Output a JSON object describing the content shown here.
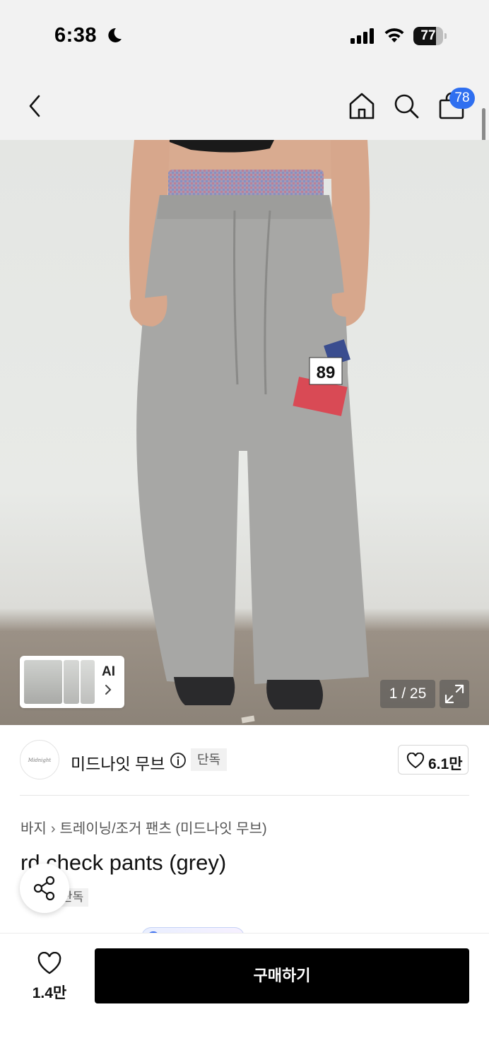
{
  "status_bar": {
    "time": "6:38",
    "battery": "77",
    "battery_level": 0.77
  },
  "nav": {
    "cart_count": "78"
  },
  "gallery": {
    "thumbnail_label": "AI",
    "counter": "1 / 25",
    "patch_number": "89"
  },
  "brand": {
    "logo_text": "Midnight Move",
    "name": "미드나잇 무브",
    "exclusive_tag": "단독",
    "like_count": "6.1만"
  },
  "product": {
    "breadcrumb": [
      "바지",
      "트레이닝/조거 팬츠 (미드나잇 무브)"
    ],
    "title": "rd check pants (grey)",
    "tag": "단독"
  },
  "bottom_bar": {
    "wish_count": "1.4만",
    "buy_label": "구매하기"
  },
  "colors": {
    "accent_blue": "#2f6ff0",
    "buy_button": "#000000",
    "header_bg": "#f2f2f2"
  }
}
